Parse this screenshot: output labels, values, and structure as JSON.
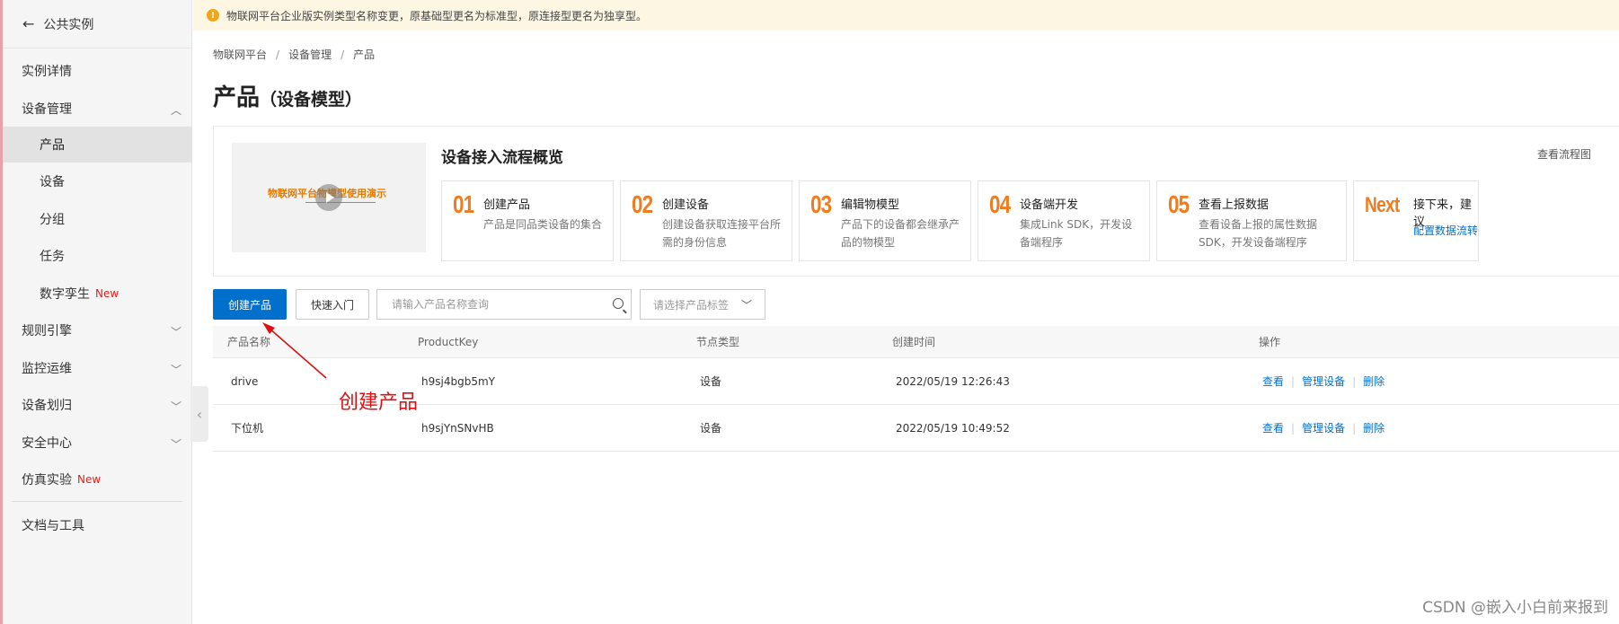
{
  "notice": {
    "text": "物联网平台企业版实例类型名称变更，原基础型更名为标准型，原连接型更名为独享型。"
  },
  "sidebar": {
    "back_label": "公共实例",
    "items": [
      {
        "label": "实例详情"
      },
      {
        "label": "设备管理"
      },
      {
        "label": "产品"
      },
      {
        "label": "设备"
      },
      {
        "label": "分组"
      },
      {
        "label": "任务"
      },
      {
        "label": "数字孪生",
        "badge": "New"
      },
      {
        "label": "规则引擎"
      },
      {
        "label": "监控运维"
      },
      {
        "label": "设备划归"
      },
      {
        "label": "安全中心"
      },
      {
        "label": "仿真实验",
        "badge": "New"
      },
      {
        "label": "文档与工具"
      }
    ]
  },
  "breadcrumb": [
    "物联网平台",
    "设备管理",
    "产品"
  ],
  "page": {
    "title": "产品",
    "subtitle": "（设备模型）"
  },
  "overview": {
    "video_text": "物联网平台物模型使用演示",
    "title": "设备接入流程概览",
    "link": "查看流程图",
    "steps": [
      {
        "num": "01",
        "title": "创建产品",
        "desc": "产品是同品类设备的集合"
      },
      {
        "num": "02",
        "title": "创建设备",
        "desc": "创建设备获取连接平台所需的身份信息"
      },
      {
        "num": "03",
        "title": "编辑物模型",
        "desc": "产品下的设备都会继承产品的物模型"
      },
      {
        "num": "04",
        "title": "设备端开发",
        "desc": "集成Link SDK，开发设备端程序"
      },
      {
        "num": "05",
        "title": "查看上报数据",
        "desc": "查看设备上报的属性数据 SDK，开发设备端程序"
      },
      {
        "num": "Next",
        "title": "接下来，建议",
        "link": "配置数据流转"
      }
    ]
  },
  "toolbar": {
    "create_label": "创建产品",
    "quickstart_label": "快速入门",
    "search_placeholder": "请输入产品名称查询",
    "tag_select_placeholder": "请选择产品标签"
  },
  "table": {
    "columns": [
      "产品名称",
      "ProductKey",
      "节点类型",
      "创建时间",
      "操作"
    ],
    "rows": [
      {
        "name": "drive",
        "key": "h9sj4bgb5mY",
        "node": "设备",
        "time": "2022/05/19 12:26:43"
      },
      {
        "name": "下位机",
        "key": "h9sjYnSNvHB",
        "node": "设备",
        "time": "2022/05/19 10:49:52"
      }
    ],
    "actions": [
      "查看",
      "管理设备",
      "删除"
    ]
  },
  "annotation": {
    "text": "创建产品"
  },
  "watermark": "CSDN @嵌入小白前来报到",
  "colors": {
    "primary": "#0070cc",
    "step_number": "#f07c1f",
    "new_badge": "#e01e1e",
    "annotation": "#dd1111"
  }
}
